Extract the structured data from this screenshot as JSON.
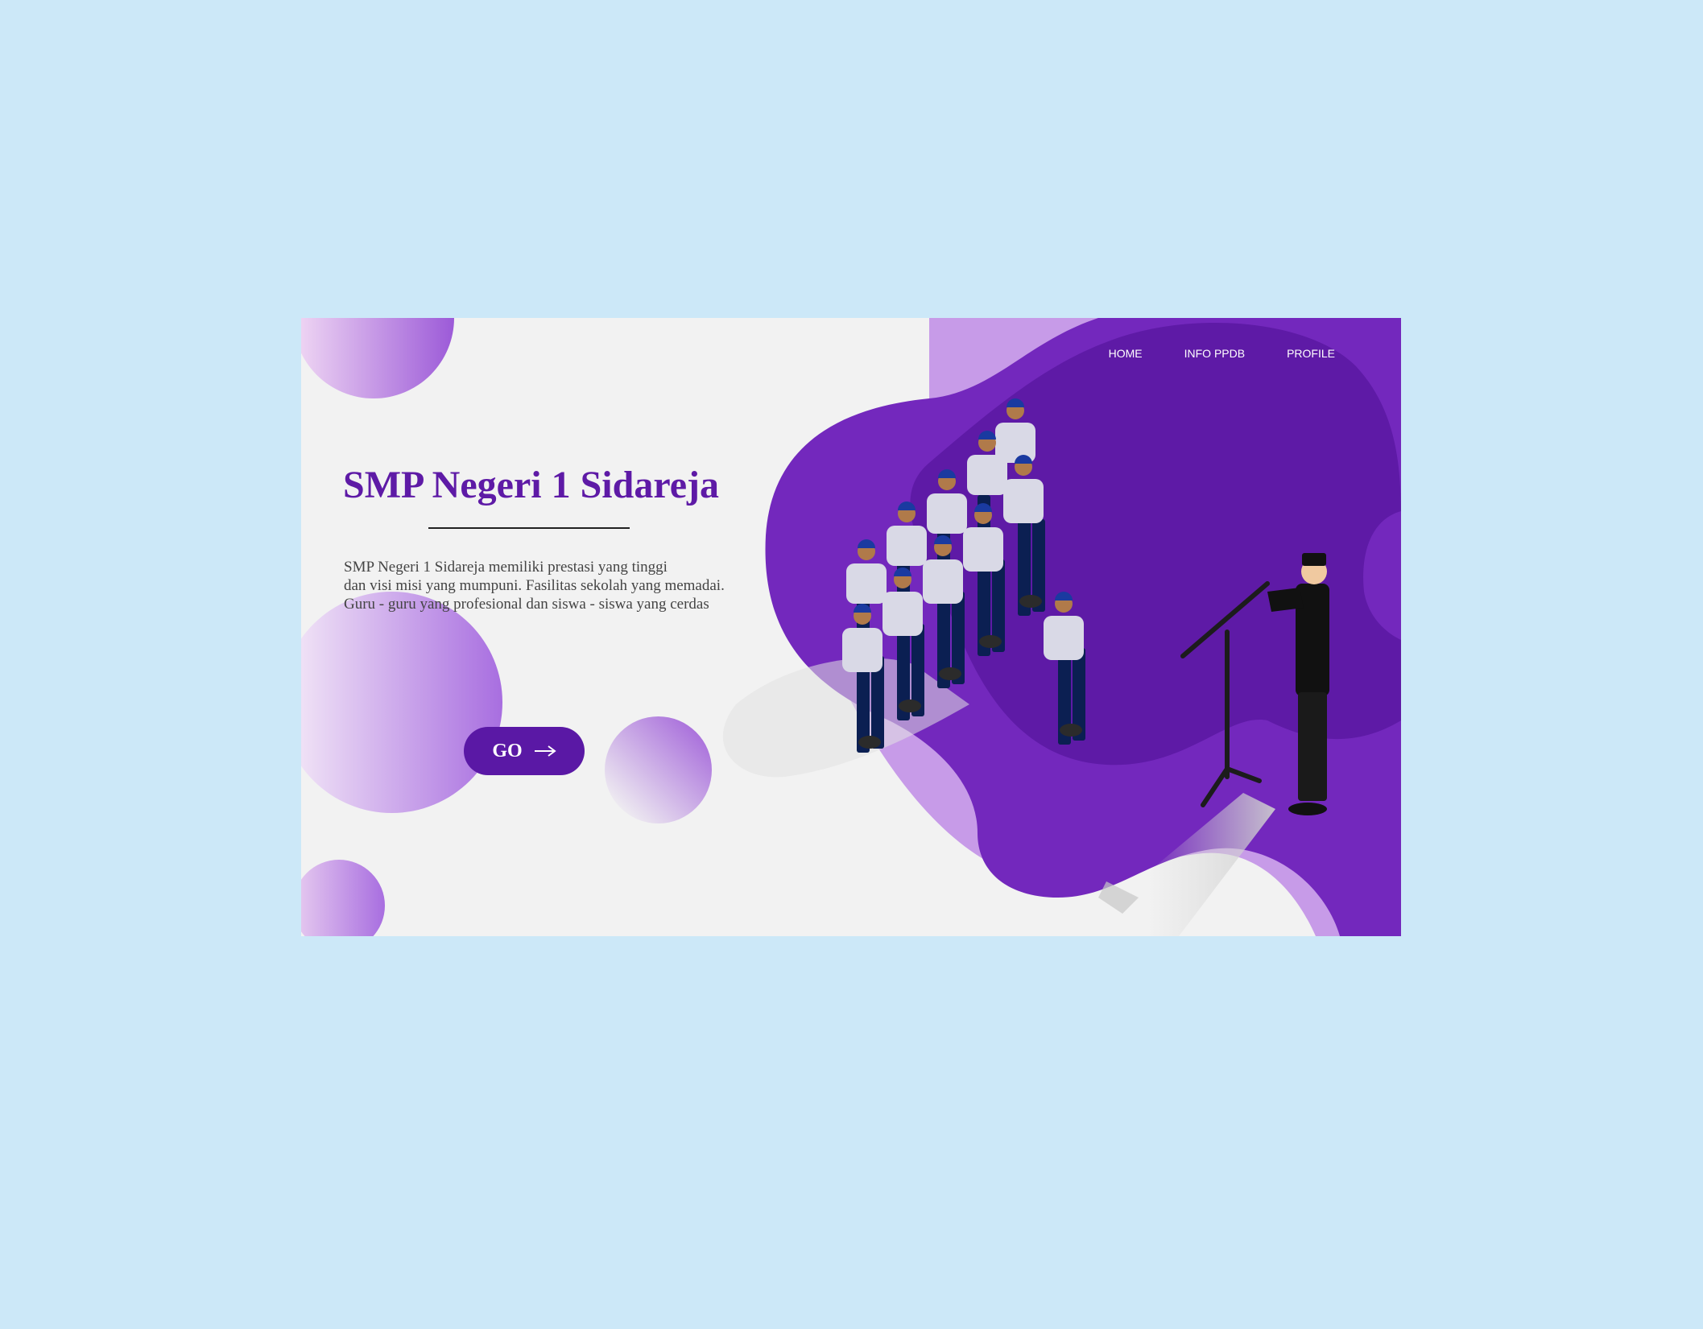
{
  "nav": {
    "items": [
      {
        "label": "HOME"
      },
      {
        "label": "INFO PPDB"
      },
      {
        "label": "PROFILE"
      }
    ]
  },
  "hero": {
    "title": "SMP Negeri 1 Sidareja",
    "description_lines": [
      "SMP Negeri 1 Sidareja memiliki prestasi yang tinggi",
      "dan visi misi yang mumpuni. Fasilitas sekolah yang memadai.",
      "Guru - guru yang profesional dan siswa - siswa yang cerdas"
    ],
    "go_label": "GO",
    "go_icon": "arrow-right-icon"
  },
  "illustration": {
    "subject": "students-assembly-with-speaker-illustration"
  },
  "colors": {
    "page_bg": "#cce8f8",
    "card_bg": "#f2f2f2",
    "brand_purple": "#5e1aa6",
    "blob_purple": "#7328bd",
    "blob_dark": "#5e1aa6",
    "blob_light": "#c79be8"
  }
}
